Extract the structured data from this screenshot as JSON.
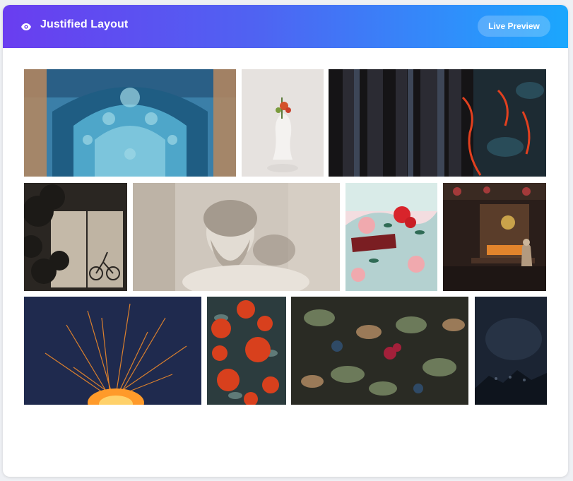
{
  "header": {
    "title": "Justified Layout",
    "eye_icon": "eye-icon",
    "button_label": "Live Preview",
    "gradient": [
      "#6a3df0",
      "#1aa7fd"
    ]
  },
  "gallery": {
    "rows": [
      [
        "mosque-ceiling-tiles",
        "vase-head-with-flower",
        "lava-tree-bark"
      ],
      [
        "bicycle-window-shadow",
        "bearded-statue",
        "red-flower-illustration",
        "shop-with-man-reading"
      ],
      [
        "fire-sparks",
        "red-roses-bush",
        "green-leaves-berries",
        "dark-night-mountain"
      ]
    ]
  }
}
